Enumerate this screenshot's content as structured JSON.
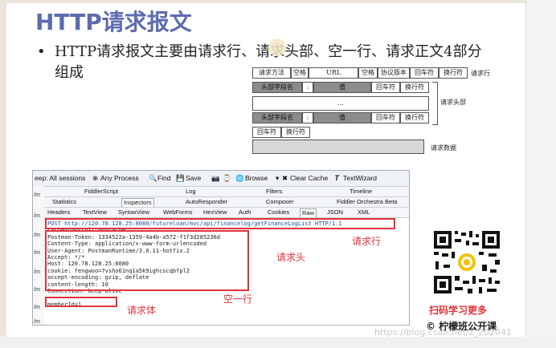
{
  "slide": {
    "title": "HTTP请求报文",
    "bullet_dot": "•",
    "bullet_text": "HTTP请求报文主要由请求行、请求头部、空一行、请求正文4部分组成"
  },
  "diagram": {
    "row1": [
      "请求方法",
      "空格",
      "URL",
      "空格",
      "协议版本",
      "回车符",
      "换行符"
    ],
    "row1_label": "请求行",
    "row2": [
      "头部字段名",
      ":",
      "值",
      "回车符",
      "换行符"
    ],
    "ellipsis": "...",
    "row4": [
      "头部字段名",
      ":",
      "值",
      "回车符",
      "换行符"
    ],
    "row5": [
      "回车符",
      "换行符"
    ],
    "header_label": "请求头部",
    "body_label": "请求数据"
  },
  "fiddler": {
    "toolbar": {
      "sessions": "eep: All sessions",
      "any_process": "Any Process",
      "find": "Find",
      "save": "Save",
      "browse": "Browse",
      "clear_cache": "Clear Cache",
      "textwizard": "TextWizard"
    },
    "tabs_row1": [
      "FiddlerScript",
      "Log",
      "Filters",
      "Timeline"
    ],
    "tabs_row2": [
      "Statistics",
      "Inspectors",
      "AutoResponder",
      "Composer",
      "Fiddler Orchestra Beta"
    ],
    "tabs_row3": [
      "Headers",
      "TextView",
      "SyntaxView",
      "WebForms",
      "HexView",
      "Auth",
      "Cookies",
      "Raw",
      "JSON",
      "XML"
    ],
    "left_marks": [
      "/m",
      "/m",
      "/m",
      "/m",
      "/m",
      "/m",
      "/m",
      "/m"
    ],
    "raw_lines": [
      "POST http://120.78.128.25:8080/futureloan/mvc/api/financelog/getFinanceLogList HTTP/1.1",
      "cache-control: no-cache",
      "Postman-Token: 1334522a-1359-4a4b-a572-f1f3d285236d",
      "Content-Type: application/x-www-form-urlencoded",
      "User-Agent: PostmanRuntime/3.0.11-hotfix.2",
      "Accept: */*",
      "Host: 120.78.128.25:8080",
      "cookie: fengwoo=7vsho61nq1a5k9ighcscqbfpl2",
      "accept-encoding: gzip, deflate",
      "content-length: 10",
      "Connection: keep-alive",
      "",
      "memberId=1"
    ]
  },
  "annotations": {
    "request_line": "请求行",
    "request_header": "请求头",
    "blank_line": "空一行",
    "request_body": "请求体"
  },
  "qr": {
    "caption": "扫码学习更多",
    "brand": "© 柠檬班公开课"
  },
  "watermark": "https://blog.csdn.net/z_202041",
  "colors": {
    "title": "#5d6bb0",
    "annotation_red": "#e0333c"
  }
}
